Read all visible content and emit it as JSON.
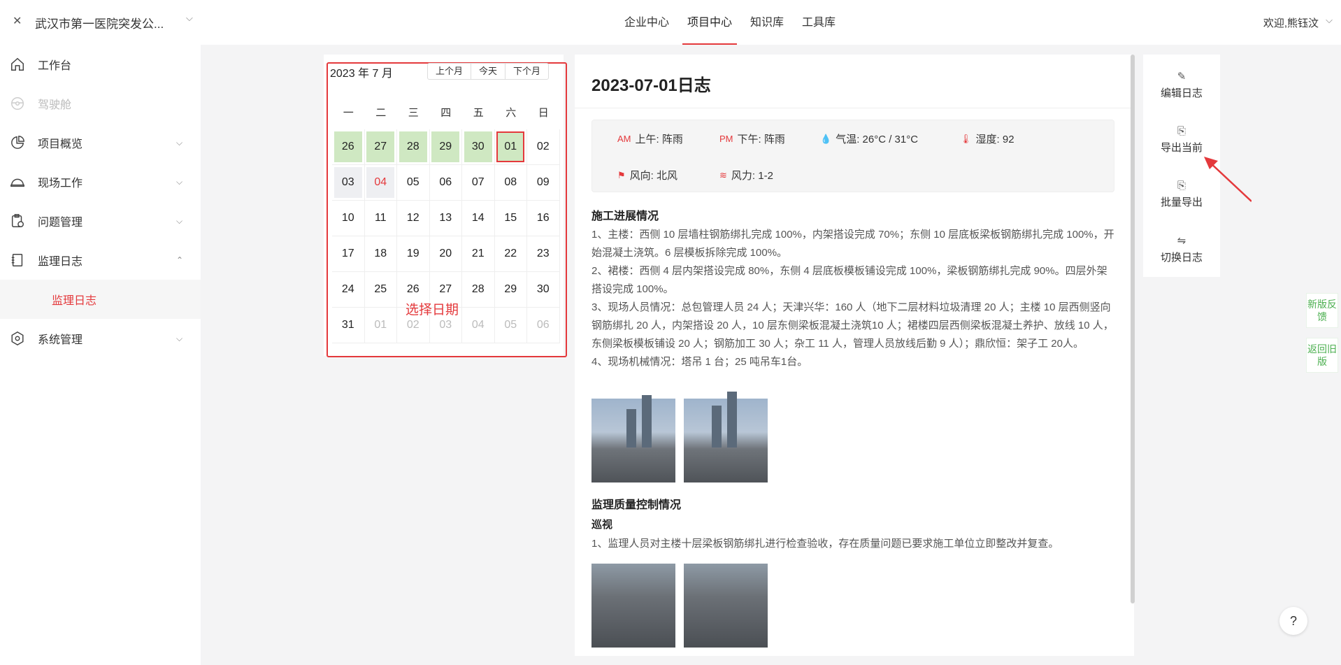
{
  "header": {
    "close_icon": "close-icon",
    "project_name": "武汉市第一医院突发公...",
    "tabs": [
      {
        "label": "企业中心",
        "active": false
      },
      {
        "label": "项目中心",
        "active": true
      },
      {
        "label": "知识库",
        "active": false
      },
      {
        "label": "工具库",
        "active": false
      }
    ],
    "welcome": "欢迎,熊钰汶"
  },
  "sidebar": {
    "items": [
      {
        "label": "工作台",
        "icon": "home-icon"
      },
      {
        "label": "驾驶舱",
        "icon": "steering-icon",
        "disabled": true
      },
      {
        "label": "项目概览",
        "icon": "pie-chart-icon"
      },
      {
        "label": "现场工作",
        "icon": "helmet-icon"
      },
      {
        "label": "问题管理",
        "icon": "clipboard-icon"
      },
      {
        "label": "监理日志",
        "icon": "notebook-icon",
        "expanded": true
      },
      {
        "label": "监理日志",
        "sub": true,
        "active": true
      },
      {
        "label": "系统管理",
        "icon": "settings-icon"
      }
    ]
  },
  "calendar": {
    "title": "2023 年 7 月",
    "prev": "上个月",
    "today": "今天",
    "next": "下个月",
    "weekdays": [
      "一",
      "二",
      "三",
      "四",
      "五",
      "六",
      "日"
    ],
    "rows": [
      [
        "26",
        "27",
        "28",
        "29",
        "30",
        "01",
        "02"
      ],
      [
        "03",
        "04",
        "05",
        "06",
        "07",
        "08",
        "09"
      ],
      [
        "10",
        "11",
        "12",
        "13",
        "14",
        "15",
        "16"
      ],
      [
        "17",
        "18",
        "19",
        "20",
        "21",
        "22",
        "23"
      ],
      [
        "24",
        "25",
        "26",
        "27",
        "28",
        "29",
        "30"
      ],
      [
        "31",
        "01",
        "02",
        "03",
        "04",
        "05",
        "06"
      ]
    ],
    "annotation": "选择日期"
  },
  "log": {
    "title": "2023-07-01日志",
    "weather": {
      "am": "上午: 阵雨",
      "pm": "下午: 阵雨",
      "temp": "气温: 26°C / 31°C",
      "humidity": "湿度: 92",
      "wind_dir": "风向: 北风",
      "wind_force": "风力: 1-2",
      "am_icon": "AM",
      "pm_icon": "PM"
    },
    "progress_title": "施工进展情况",
    "progress_paragraphs": [
      "1、主楼：西侧 10 层墙柱钢筋绑扎完成 100%，内架搭设完成 70%；东侧 10 层底板梁板钢筋绑扎完成 100%，开始混凝土浇筑。6 层模板拆除完成 100%。",
      "2、裙楼：西侧 4 层内架搭设完成 80%，东侧 4 层底板模板铺设完成 100%，梁板钢筋绑扎完成 90%。四层外架搭设完成 100%。",
      "3、现场人员情况：总包管理人员 24 人；天津兴华：160 人（地下二层材料垃圾清理 20 人；主楼 10 层西侧竖向钢筋绑扎 20 人，内架搭设 20 人，10 层东侧梁板混凝土浇筑10 人；裙楼四层西侧梁板混凝土养护、放线 10 人，东侧梁板模板铺设 20 人；钢筋加工 30 人；杂工 11 人，管理人员放线后勤 9 人）；鼎欣恒：架子工 20人。",
      "4、现场机械情况：塔吊 1 台；25 吨吊车1台。"
    ],
    "quality_title": "监理质量控制情况",
    "patrol_title": "巡视",
    "patrol_text": "1、监理人员对主楼十层梁板钢筋绑扎进行检查验收，存在质量问题已要求施工单位立即整改并复查。"
  },
  "actions": [
    {
      "label": "编辑日志",
      "icon": "edit-icon"
    },
    {
      "label": "导出当前",
      "icon": "export-icon"
    },
    {
      "label": "批量导出",
      "icon": "batch-export-icon"
    },
    {
      "label": "切换日志",
      "icon": "switch-icon"
    }
  ],
  "float": {
    "feedback": "新版反馈",
    "back": "返回旧版",
    "help": "?"
  },
  "colors": {
    "accent": "#e4393c",
    "highlight_green": "#cfe8c2",
    "float_green": "#4caf50"
  }
}
